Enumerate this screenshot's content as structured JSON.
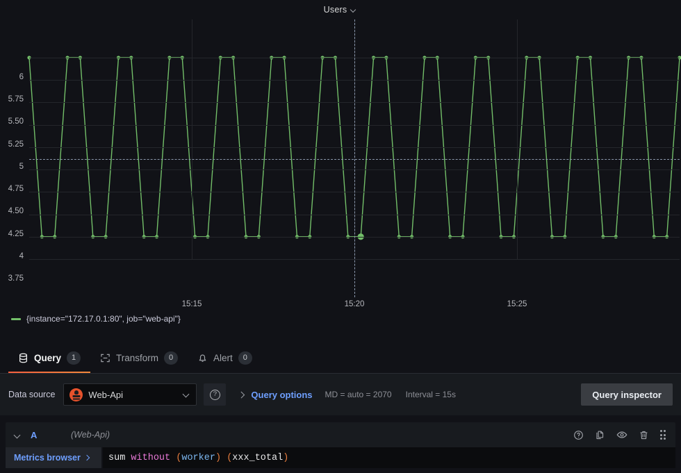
{
  "panel": {
    "title": "Users",
    "menu_icon": "chevron-down-icon"
  },
  "chart_data": {
    "type": "line",
    "title": "Users",
    "xlabel": "",
    "ylabel": "",
    "ylim": [
      3.75,
      6.0
    ],
    "xlim": [
      "15:12:30",
      "15:27:30"
    ],
    "grid": true,
    "legend_position": "bottom-left",
    "y_ticks": [
      "6",
      "5.75",
      "5.50",
      "5.25",
      "5",
      "4.75",
      "4.50",
      "4.25",
      "4",
      "3.75"
    ],
    "y_tick_values": [
      6,
      5.75,
      5.5,
      5.25,
      5,
      4.75,
      4.5,
      4.25,
      4,
      3.75
    ],
    "x_ticks": [
      "15:15",
      "15:20",
      "15:25"
    ],
    "threshold": {
      "value": 4.87,
      "style": "dashed",
      "color": "#8b98ad"
    },
    "crosshair": {
      "x_fraction": 0.5,
      "style": "dashed",
      "color": "#8b98ad"
    },
    "series": [
      {
        "name": "{instance=\"172.17.0.1:80\", job=\"web-api\"}",
        "color": "#73bf69",
        "values": [
          6,
          4,
          4,
          6,
          6,
          4,
          4,
          6,
          6,
          4,
          4,
          6,
          6,
          4,
          4,
          6,
          6,
          4,
          4,
          6,
          6,
          4,
          4,
          6,
          6,
          4,
          4,
          6,
          6,
          4,
          4,
          6,
          6,
          4,
          4,
          6,
          6,
          4,
          4,
          6,
          6,
          4,
          4,
          6,
          6,
          4,
          4,
          6,
          6,
          4,
          4,
          6
        ]
      }
    ],
    "legend": [
      {
        "label": "{instance=\"172.17.0.1:80\", job=\"web-api\"}",
        "color": "#73bf69"
      }
    ]
  },
  "tabs": [
    {
      "id": "query",
      "label": "Query",
      "count": "1",
      "icon": "database-icon",
      "active": true
    },
    {
      "id": "transform",
      "label": "Transform",
      "count": "0",
      "icon": "transform-icon",
      "active": false
    },
    {
      "id": "alert",
      "label": "Alert",
      "count": "0",
      "icon": "bell-icon",
      "active": false
    }
  ],
  "datasource_row": {
    "label": "Data source",
    "selected": "Web-Api",
    "datasource_icon": "prometheus-icon",
    "dropdown_icon": "chevron-down-icon",
    "help_icon": "help-circle-icon",
    "query_options_label": "Query options",
    "query_options_caret": "chevron-right-icon",
    "max_data_points": "MD = auto = 2070",
    "interval": "Interval = 15s",
    "query_inspector_label": "Query inspector"
  },
  "query": {
    "collapse_icon": "chevron-down-icon",
    "ref_id": "A",
    "datasource_note": "(Web-Api)",
    "actions": [
      {
        "name": "help-icon",
        "glyph": "?"
      },
      {
        "name": "duplicate-icon"
      },
      {
        "name": "eye-icon"
      },
      {
        "name": "trash-icon"
      },
      {
        "name": "drag-handle-icon"
      }
    ],
    "metrics_browser_label": "Metrics browser",
    "metrics_browser_caret": "chevron-right-icon",
    "expression": "sum without (worker) (xxx_total)",
    "expression_tokens": [
      {
        "text": "sum",
        "color": "#e8e8e9"
      },
      {
        "text": " ",
        "color": "#e8e8e9"
      },
      {
        "text": "without",
        "color": "#e879d6"
      },
      {
        "text": " ",
        "color": "#e8e8e9"
      },
      {
        "text": "(",
        "color": "#e87d3e"
      },
      {
        "text": "worker",
        "color": "#7cb7f0"
      },
      {
        "text": ")",
        "color": "#e87d3e"
      },
      {
        "text": " ",
        "color": "#e8e8e9"
      },
      {
        "text": "(",
        "color": "#e87d3e"
      },
      {
        "text": "xxx_total",
        "color": "#e8e8e9"
      },
      {
        "text": ")",
        "color": "#e87d3e"
      }
    ]
  },
  "colors": {
    "series_green": "#73bf69",
    "accent_blue": "#6e9fff",
    "tab_active_underline": "#f55f3e",
    "panel_bg": "#111217",
    "editor_bg": "#181b1f",
    "input_bg": "#0b0c0e"
  }
}
